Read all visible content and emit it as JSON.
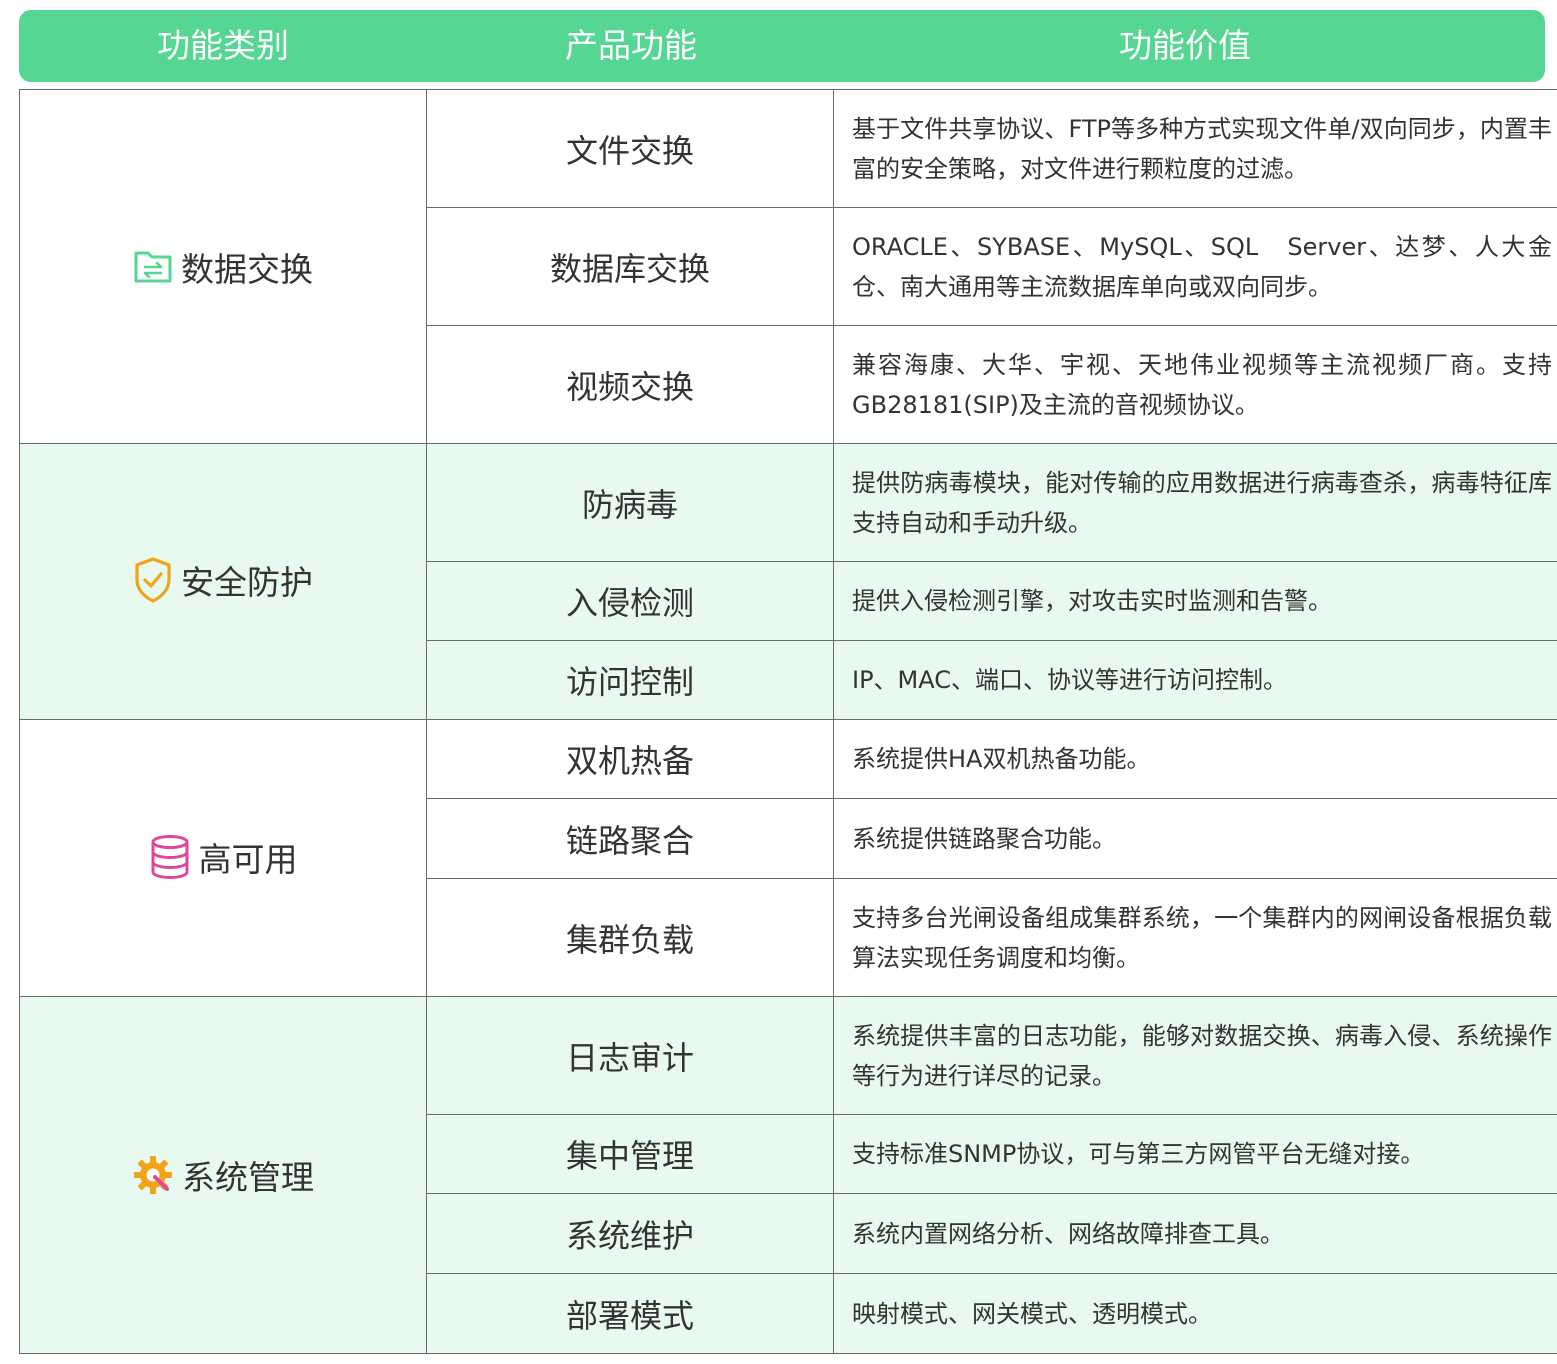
{
  "colors": {
    "header_bg": "#55d692",
    "green_band": "#e8faf0",
    "border": "#6b6b6b"
  },
  "header": {
    "col1": "功能类别",
    "col2": "产品功能",
    "col3": "功能价值"
  },
  "categories": [
    {
      "label": "数据交换",
      "icon": "folder-exchange-icon",
      "rows": [
        {
          "feature": "文件交换",
          "value": "基于文件共享协议、FTP等多种方式实现文件单/双向同步，内置丰富的安全策略，对文件进行颗粒度的过滤。"
        },
        {
          "feature": "数据库交换",
          "value": "ORACLE、SYBASE、MySQL、SQL　Server、达梦、人大金仓、南大通用等主流数据库单向或双向同步。"
        },
        {
          "feature": "视频交换",
          "value": "兼容海康、大华、宇视、天地伟业视频等主流视频厂商。支持GB28181(SIP)及主流的音视频协议。"
        }
      ]
    },
    {
      "label": "安全防护",
      "icon": "shield-check-icon",
      "rows": [
        {
          "feature": "防病毒",
          "value": "提供防病毒模块，能对传输的应用数据进行病毒查杀，病毒特征库支持自动和手动升级。"
        },
        {
          "feature": "入侵检测",
          "value": "提供入侵检测引擎，对攻击实时监测和告警。"
        },
        {
          "feature": "访问控制",
          "value": "IP、MAC、端口、协议等进行访问控制。"
        }
      ]
    },
    {
      "label": "高可用",
      "icon": "database-icon",
      "rows": [
        {
          "feature": "双机热备",
          "value": "系统提供HA双机热备功能。"
        },
        {
          "feature": "链路聚合",
          "value": "系统提供链路聚合功能。"
        },
        {
          "feature": "集群负载",
          "value": "支持多台光闸设备组成集群系统，一个集群内的网闸设备根据负载算法实现任务调度和均衡。"
        }
      ]
    },
    {
      "label": "系统管理",
      "icon": "gear-wrench-icon",
      "rows": [
        {
          "feature": "日志审计",
          "value": "系统提供丰富的日志功能，能够对数据交换、病毒入侵、系统操作等行为进行详尽的记录。"
        },
        {
          "feature": "集中管理",
          "value": "支持标准SNMP协议，可与第三方网管平台无缝对接。"
        },
        {
          "feature": "系统维护",
          "value": "系统内置网络分析、网络故障排查工具。"
        },
        {
          "feature": "部署模式",
          "value": "映射模式、网关模式、透明模式。"
        }
      ]
    }
  ]
}
